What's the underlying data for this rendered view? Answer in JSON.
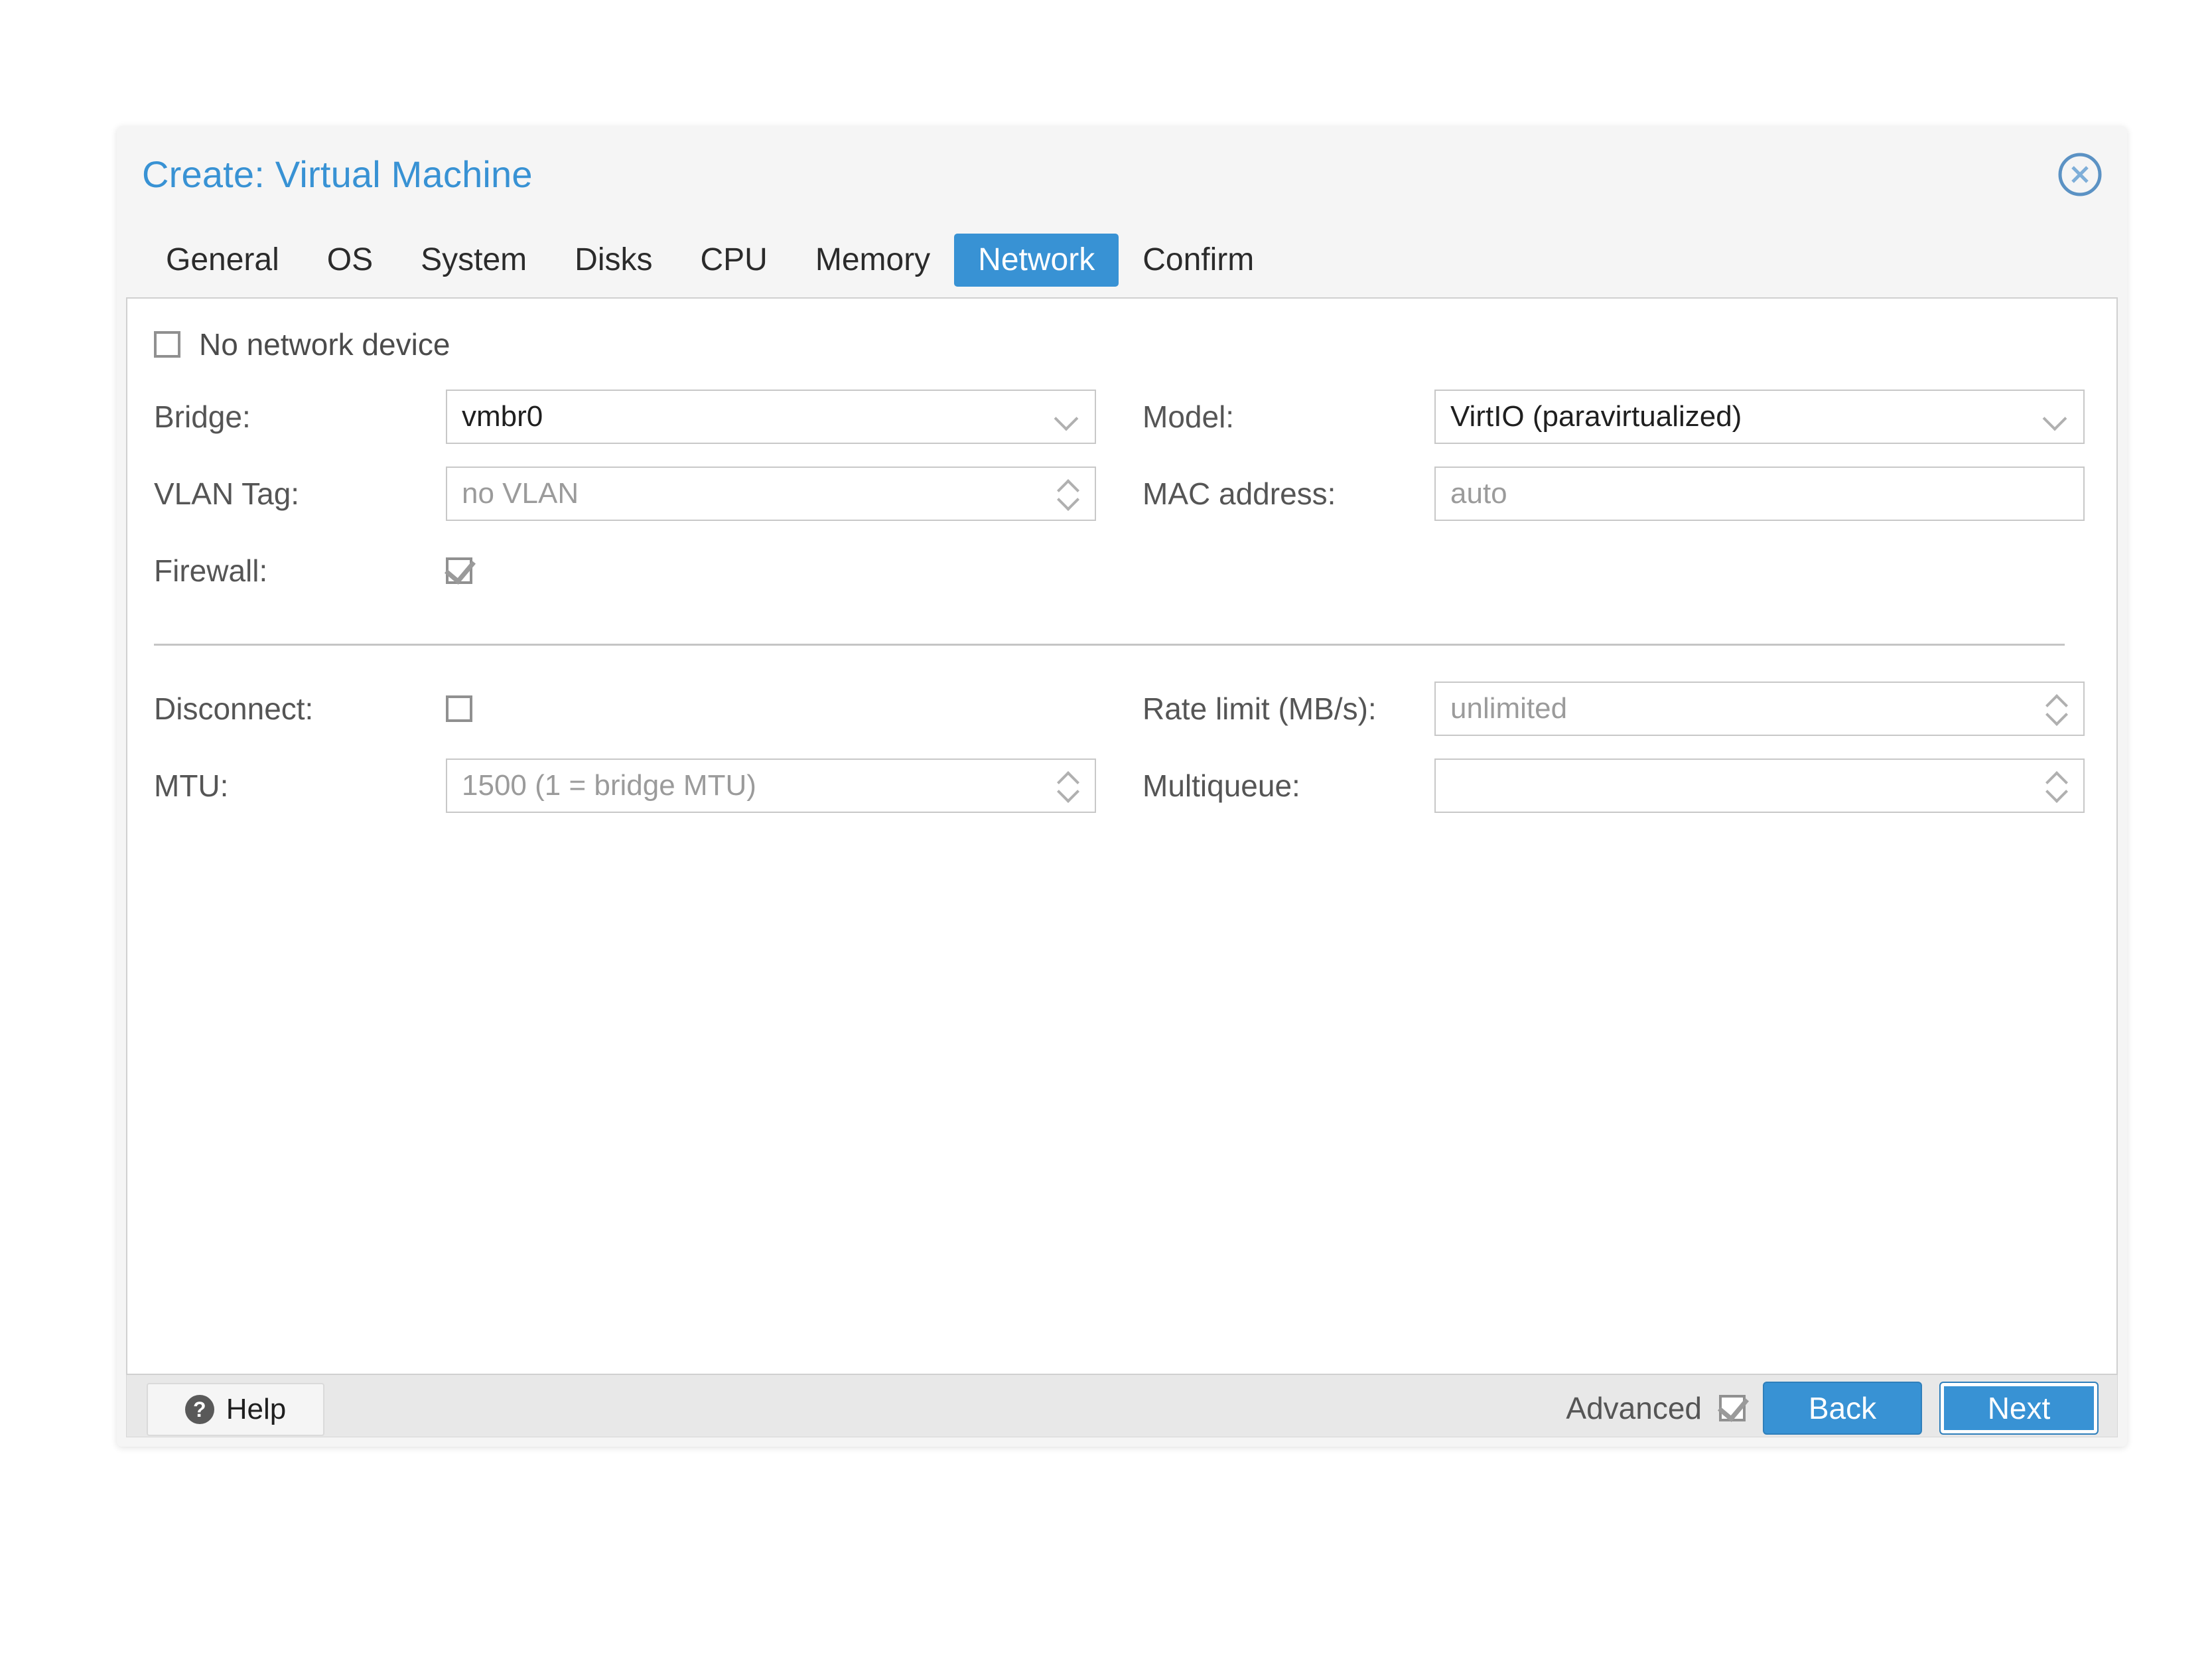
{
  "dialog": {
    "title": "Create: Virtual Machine",
    "close_icon": "close-circle-icon"
  },
  "tabs": [
    {
      "label": "General",
      "active": false
    },
    {
      "label": "OS",
      "active": false
    },
    {
      "label": "System",
      "active": false
    },
    {
      "label": "Disks",
      "active": false
    },
    {
      "label": "CPU",
      "active": false
    },
    {
      "label": "Memory",
      "active": false
    },
    {
      "label": "Network",
      "active": true
    },
    {
      "label": "Confirm",
      "active": false
    }
  ],
  "form": {
    "no_network_device": {
      "label": "No network device",
      "checked": false
    },
    "bridge": {
      "label": "Bridge:",
      "value": "vmbr0",
      "is_placeholder": false
    },
    "vlan_tag": {
      "label": "VLAN Tag:",
      "value": "no VLAN",
      "is_placeholder": true
    },
    "firewall": {
      "label": "Firewall:",
      "checked": true
    },
    "model": {
      "label": "Model:",
      "value": "VirtIO (paravirtualized)",
      "is_placeholder": false
    },
    "mac_address": {
      "label": "MAC address:",
      "value": "auto",
      "is_placeholder": true
    },
    "disconnect": {
      "label": "Disconnect:",
      "checked": false
    },
    "mtu": {
      "label": "MTU:",
      "value": "1500 (1 = bridge MTU)",
      "is_placeholder": true
    },
    "rate_limit": {
      "label": "Rate limit (MB/s):",
      "value": "unlimited",
      "is_placeholder": true
    },
    "multiqueue": {
      "label": "Multiqueue:",
      "value": "",
      "is_placeholder": true
    }
  },
  "footer": {
    "help_label": "Help",
    "help_icon": "question-mark-icon",
    "advanced_label": "Advanced",
    "advanced_checked": true,
    "back_label": "Back",
    "next_label": "Next"
  },
  "colors": {
    "accent": "#3892d4",
    "title": "#3892d4",
    "label": "#555555",
    "placeholder": "#9b9b9b",
    "value": "#1f1f1f",
    "panel_bg": "#ffffff",
    "dialog_bg": "#f5f5f5",
    "footer_bg": "#e8e8e8"
  }
}
